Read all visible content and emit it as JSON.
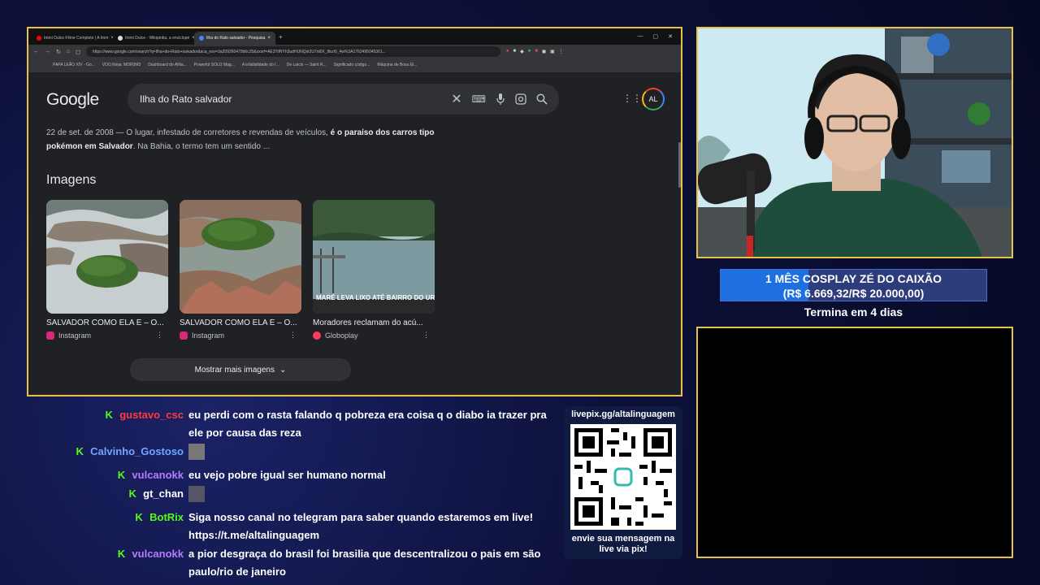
{
  "browser": {
    "tabs": [
      {
        "title": "Immi Dulce Filme Completo | A Imm",
        "favicon_color": "#ff0000",
        "active": false
      },
      {
        "title": "Immi Dulce - Wikipédia, a enciclopé",
        "favicon_color": "#dddddd",
        "active": false
      },
      {
        "title": "Ilha do Rato salvador - Pesquisa",
        "favicon_color": "#4285f4",
        "active": true
      }
    ],
    "new_tab": "+",
    "url": "https://www.google.com/search?q=Ilha+do+Rato+salvador&sca_esv=3a209260479b6c25&sxsrf=AE3TifNYh3udHUNQxt2U7nl0X_9bzI0_4w%3A1762495045361...",
    "bookmarks": [
      "PAPA LEÃO XIV - Go...",
      "VDO.Ninja: MDR9M3",
      "Dashboard do Afilia...",
      "Powerful SOLO Mag...",
      "A infalibilidade do I...",
      "De Laicis — Saint R...",
      "Significado código...",
      "Máquina de Bosa El..."
    ]
  },
  "google": {
    "logo": "Google",
    "query": "Ilha do Rato salvador",
    "avatar": "AL",
    "snippet": {
      "date": "22 de set. de 2008 — O lugar, infestado de corretores e revendas de veículos, ",
      "bold": "é o paraíso dos carros tipo pokémon em Salvador",
      "rest": ". Na Bahia, o termo tem um sentido ..."
    },
    "images_heading": "Imagens",
    "images": [
      {
        "title": "SALVADOR COMO ELA É – O...",
        "source": "Instagram",
        "source_color": "#d62976"
      },
      {
        "title": "SALVADOR COMO ELA É – O...",
        "source": "Instagram",
        "source_color": "#d62976"
      },
      {
        "title": "Moradores reclamam do acú...",
        "source": "Globoplay",
        "source_color": "#ff3b5c",
        "overlay": "MARÉ LEVA LIXO ATÉ BAIRRO DO URUG"
      }
    ],
    "show_more": "Mostrar mais imagens"
  },
  "goal": {
    "title": "1 MÊS COSPLAY ZÉ DO CAIXÃO",
    "amount": "(R$ 6.669,32/R$ 20.000,00)",
    "progress": 0.333,
    "ends": "Termina em 4 dias"
  },
  "chat": [
    {
      "user": "gustavo_csc",
      "color": "#ff3b3b",
      "text": "eu perdi com o rasta falando q pobreza era coisa q o diabo ia trazer pra ele por causa das reza"
    },
    {
      "user": "Calvinho_Gostoso",
      "color": "#6fa8ff",
      "text": ""
    },
    {
      "user": "vulcanokk",
      "color": "#b57cff",
      "text": "eu vejo pobre igual ser humano normal"
    },
    {
      "user": "gt_chan",
      "color": "#ffffff",
      "text": ""
    },
    {
      "user": "BotRix",
      "color": "#53fc18",
      "text": "Siga nosso canal no telegram para saber quando estaremos em live! https://t.me/altalinguagem"
    },
    {
      "user": "vulcanokk",
      "color": "#b57cff",
      "text": "a pior desgraça do brasil foi brasilia que descentralizou o pais em são paulo/rio de janeiro"
    }
  ],
  "qr": {
    "url": "livepix.gg/altalinguagem",
    "caption": "envie sua mensagem na live via pix!"
  }
}
